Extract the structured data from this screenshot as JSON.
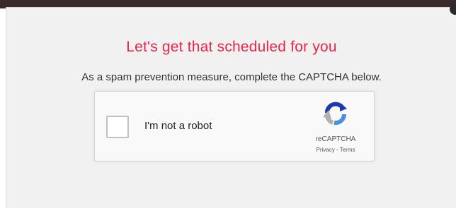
{
  "dialog": {
    "title": "Let's get that scheduled for you",
    "subtitle": "As a spam prevention measure, complete the CAPTCHA below."
  },
  "captcha": {
    "checkbox_label": "I'm not a robot",
    "checked": false,
    "brand": "reCAPTCHA",
    "privacy_link": "Privacy",
    "separator": " - ",
    "terms_link": "Terms",
    "logo_icon": "recaptcha-logo-icon"
  },
  "colors": {
    "title": "#e8254a",
    "modal_bg": "#f1f1f1",
    "captcha_bg": "#f9f9f9",
    "logo_blue_dark": "#1c3aa9",
    "logo_blue_light": "#4a90e2",
    "logo_gray": "#b0b0b0"
  }
}
